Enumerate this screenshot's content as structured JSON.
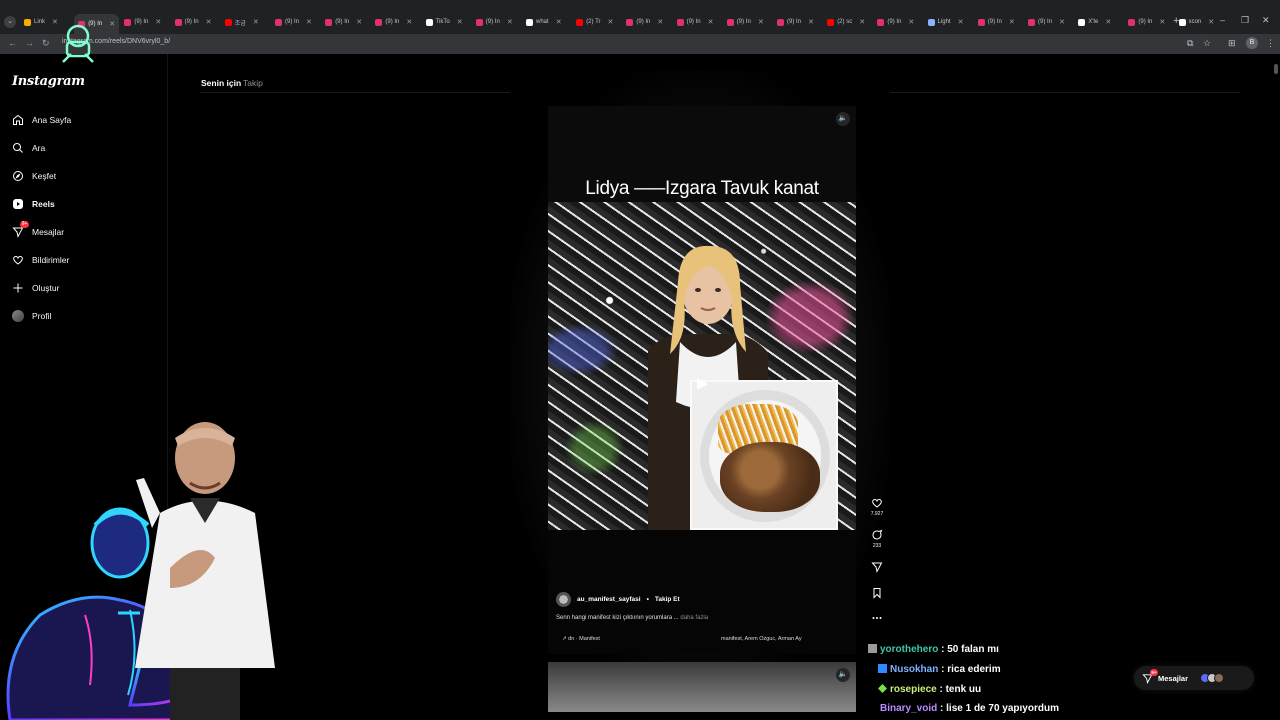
{
  "browser": {
    "tabs": [
      {
        "label": "Link",
        "color": "#f9ab00"
      },
      {
        "label": "(9) In",
        "color": "#e1306c",
        "active": true
      },
      {
        "label": "(9) In",
        "color": "#e1306c"
      },
      {
        "label": "(9) In",
        "color": "#e1306c"
      },
      {
        "label": "조금",
        "color": "#ff0000"
      },
      {
        "label": "(9) In",
        "color": "#e1306c"
      },
      {
        "label": "(9) In",
        "color": "#e1306c"
      },
      {
        "label": "(9) In",
        "color": "#e1306c"
      },
      {
        "label": "TikTo",
        "color": "#ffffff"
      },
      {
        "label": "(9) In",
        "color": "#e1306c"
      },
      {
        "label": "what",
        "color": "#ffffff"
      },
      {
        "label": "(2) Tr",
        "color": "#ff0000"
      },
      {
        "label": "(9) In",
        "color": "#e1306c"
      },
      {
        "label": "(9) In",
        "color": "#e1306c"
      },
      {
        "label": "(9) In",
        "color": "#e1306c"
      },
      {
        "label": "(9) In",
        "color": "#e1306c"
      },
      {
        "label": "(2) sc",
        "color": "#ff0000"
      },
      {
        "label": "(9) In",
        "color": "#e1306c"
      },
      {
        "label": "Light",
        "color": "#8ab4f8"
      },
      {
        "label": "(9) In",
        "color": "#e1306c"
      },
      {
        "label": "(9) In",
        "color": "#e1306c"
      },
      {
        "label": "X'te",
        "color": "#ffffff"
      },
      {
        "label": "(9) In",
        "color": "#e1306c"
      },
      {
        "label": "xcon",
        "color": "#ffffff"
      }
    ],
    "url": "instagram.com/reels/DNV6vryl0_b/",
    "profile_initial": "B"
  },
  "instagram": {
    "logo": "Instagram",
    "nav": [
      {
        "label": "Ana Sayfa",
        "icon": "home-icon"
      },
      {
        "label": "Ara",
        "icon": "search-icon"
      },
      {
        "label": "Keşfet",
        "icon": "explore-icon"
      },
      {
        "label": "Reels",
        "icon": "reels-icon",
        "active": true
      },
      {
        "label": "Mesajlar",
        "icon": "messages-icon",
        "badge": "9+"
      },
      {
        "label": "Bildirimler",
        "icon": "heart-icon"
      },
      {
        "label": "Oluştur",
        "icon": "plus-icon"
      },
      {
        "label": "Profil",
        "icon": "avatar"
      }
    ],
    "feed_tabs": {
      "for_you": "Senin için",
      "following": "Takip"
    },
    "reel": {
      "caption_overlay": "Lidya –––Izgara Tavuk kanat",
      "author": "au_manifest_sayfasi",
      "separator": "•",
      "follow": "Takip Et",
      "description": "Senn hangi manifest kizi çıktıının yorumlara ...",
      "more": "daha fazla",
      "audio": "↗ dn · Manifest",
      "tagged": "manifest, Arem Ozguc, Arman Ay"
    },
    "actions": {
      "likes": "7.927",
      "comments": "233"
    },
    "messages_pill": {
      "label": "Mesajlar",
      "badge": "9+"
    }
  },
  "chat": [
    {
      "user": "yorothehero",
      "message": "50 falan mı",
      "color": "#3ec7a6"
    },
    {
      "user": "Nusokhan",
      "message": "rica ederim",
      "color": "#7fb2ff"
    },
    {
      "user": "rosepiece",
      "message": "tenk uu",
      "color": "#c8f07a"
    },
    {
      "user": "Binary_void",
      "message": "lise 1 de 70 yapıyordum",
      "color": "#b98cff"
    }
  ],
  "colors": {
    "accent_badge": "#ff3040",
    "background": "#000000"
  }
}
